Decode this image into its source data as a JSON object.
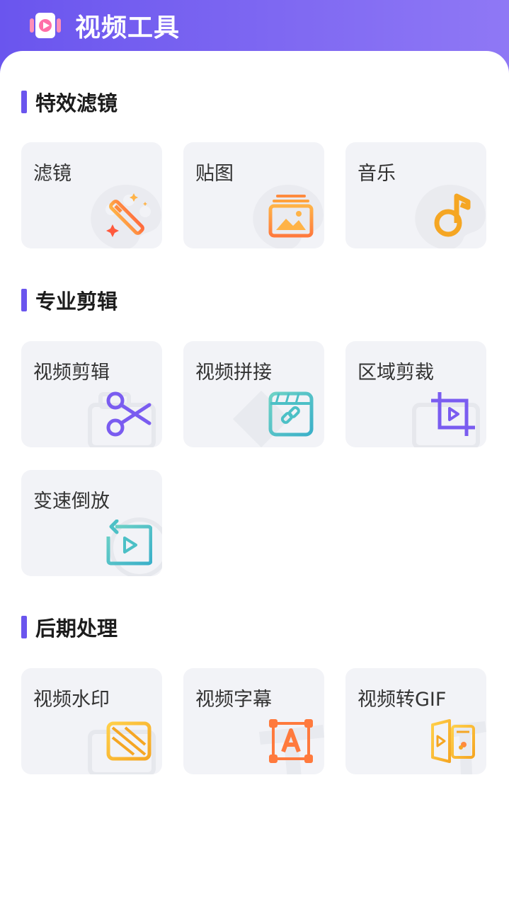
{
  "header": {
    "title": "视频工具"
  },
  "sections": [
    {
      "title": "特效滤镜"
    },
    {
      "title": "专业剪辑"
    },
    {
      "title": "后期处理"
    }
  ],
  "tools": {
    "filter": "滤镜",
    "sticker": "贴图",
    "music": "音乐",
    "video_edit": "视频剪辑",
    "video_merge": "视频拼接",
    "area_crop": "区域剪裁",
    "speed_reverse": "变速倒放",
    "watermark": "视频水印",
    "subtitle": "视频字幕",
    "to_gif": "视频转GIF"
  },
  "colors": {
    "accent": "#6a55ee",
    "card_bg": "#f2f3f7",
    "orange": "#f5a623",
    "purple": "#7a5cf0",
    "teal": "#3bbcc0"
  }
}
